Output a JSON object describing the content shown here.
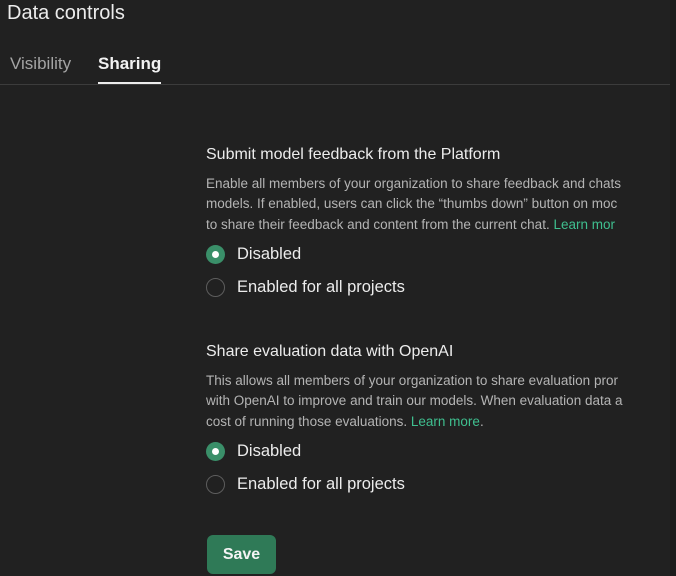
{
  "header": {
    "title": "Data controls"
  },
  "tabs": [
    {
      "label": "Visibility",
      "active": false
    },
    {
      "label": "Sharing",
      "active": true
    }
  ],
  "sections": [
    {
      "title": "Submit model feedback from the Platform",
      "description_lines": [
        "Enable all members of your organization to share feedback and chats",
        "models. If enabled, users can click the “thumbs down” button on moc",
        "to share their feedback and content from the current chat. "
      ],
      "learn_more": "Learn mor",
      "learn_more_suffix": "",
      "options": [
        {
          "label": "Disabled",
          "selected": true
        },
        {
          "label": "Enabled for all projects",
          "selected": false
        }
      ]
    },
    {
      "title": "Share evaluation data with OpenAI",
      "description_lines": [
        "This allows all members of your organization to share evaluation pror",
        "with OpenAI to improve and train our models. When evaluation data a",
        "cost of running those evaluations. "
      ],
      "learn_more": "Learn more",
      "learn_more_suffix": ".",
      "options": [
        {
          "label": "Disabled",
          "selected": true
        },
        {
          "label": "Enabled for all projects",
          "selected": false
        }
      ]
    }
  ],
  "footer": {
    "save_label": "Save"
  },
  "colors": {
    "background": "#212121",
    "accent": "#3a8f69",
    "link": "#3fbf8f",
    "save_button": "#2f7a57"
  }
}
